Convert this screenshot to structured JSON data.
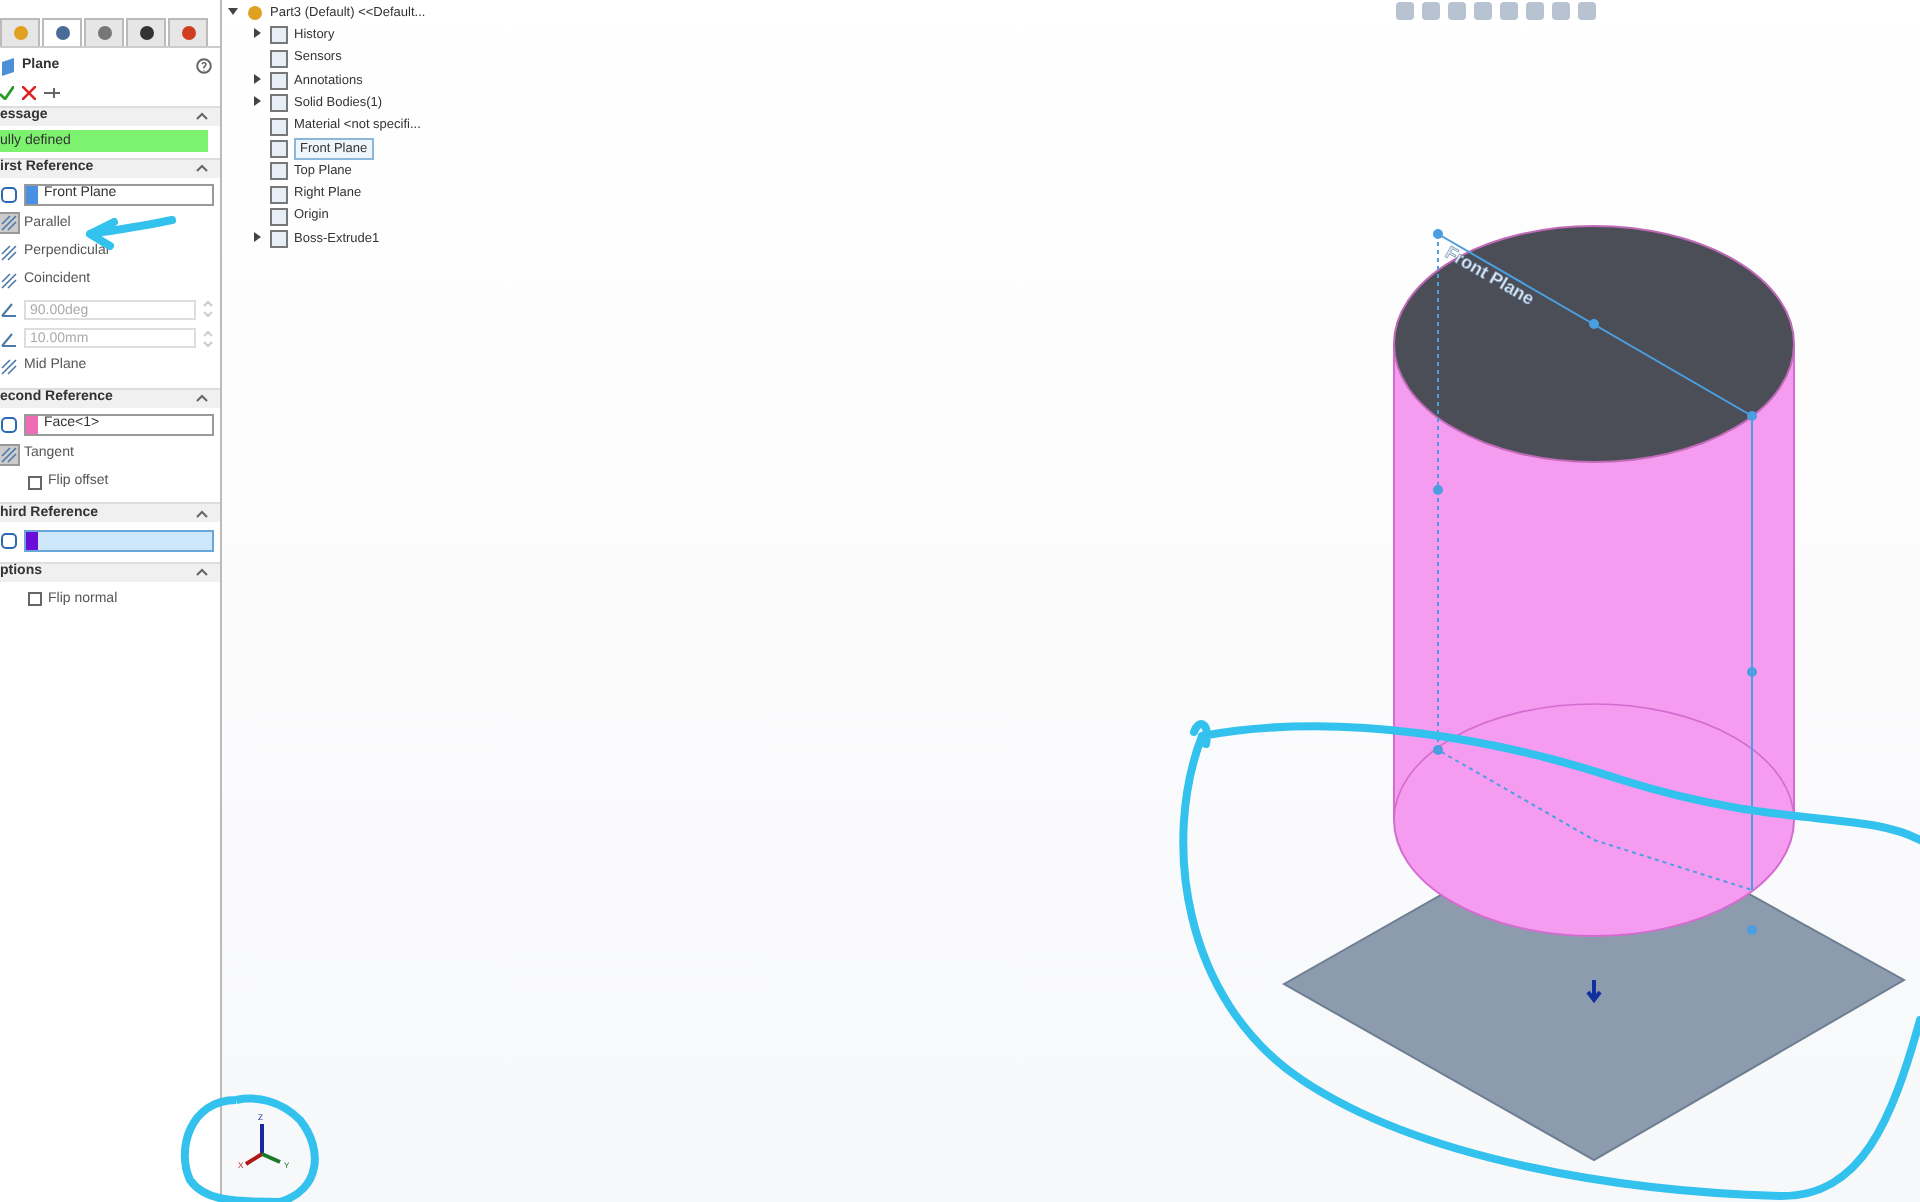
{
  "panel_tabs": [
    {
      "selected": false
    },
    {
      "selected": true
    },
    {
      "selected": false
    },
    {
      "selected": false
    },
    {
      "selected": false
    }
  ],
  "feature_title": "Plane",
  "sections": [
    {
      "title": "essage",
      "items": [
        {
          "kind": "message",
          "text": "ully defined"
        }
      ]
    },
    {
      "title": "irst Reference",
      "items": [
        {
          "kind": "ref",
          "value": "Front Plane",
          "color": "#4a90e2",
          "active": false
        },
        {
          "kind": "option",
          "label": "Parallel",
          "selected": true
        },
        {
          "kind": "option",
          "label": "Perpendicular",
          "selected": false
        },
        {
          "kind": "option",
          "label": "Coincident",
          "selected": false
        },
        {
          "kind": "spin",
          "value": "90.00deg"
        },
        {
          "kind": "spin",
          "value": "10.00mm"
        },
        {
          "kind": "option",
          "label": "Mid Plane",
          "selected": false
        }
      ]
    },
    {
      "title": "econd Reference",
      "items": [
        {
          "kind": "ref",
          "value": "Face<1>",
          "color": "#f06cb4",
          "active": false
        },
        {
          "kind": "option",
          "label": "Tangent",
          "selected": true
        },
        {
          "kind": "check",
          "label": "Flip offset",
          "checked": false
        }
      ]
    },
    {
      "title": "hird Reference",
      "items": [
        {
          "kind": "ref",
          "value": "",
          "color": "#6a0dd8",
          "active": true
        }
      ]
    },
    {
      "title": "ptions",
      "items": [
        {
          "kind": "check",
          "label": "Flip normal",
          "checked": false
        }
      ]
    }
  ],
  "tree": {
    "label": "Part3 (Default) <<Default...",
    "expanded": true,
    "children": [
      {
        "label": "History",
        "has_children": true,
        "selected": false
      },
      {
        "label": "Sensors",
        "has_children": false,
        "selected": false
      },
      {
        "label": "Annotations",
        "has_children": true,
        "selected": false
      },
      {
        "label": "Solid Bodies(1)",
        "has_children": true,
        "selected": false
      },
      {
        "label": "Material <not specifi...",
        "has_children": false,
        "selected": false
      },
      {
        "label": "Front Plane",
        "has_children": false,
        "selected": true
      },
      {
        "label": "Top Plane",
        "has_children": false,
        "selected": false
      },
      {
        "label": "Right Plane",
        "has_children": false,
        "selected": false
      },
      {
        "label": "Origin",
        "has_children": false,
        "selected": false
      },
      {
        "label": "Boss-Extrude1",
        "has_children": true,
        "selected": false
      }
    ]
  },
  "plane_label": "Front Plane",
  "triad": {
    "x": "X",
    "y": "Y",
    "z": "Z"
  }
}
